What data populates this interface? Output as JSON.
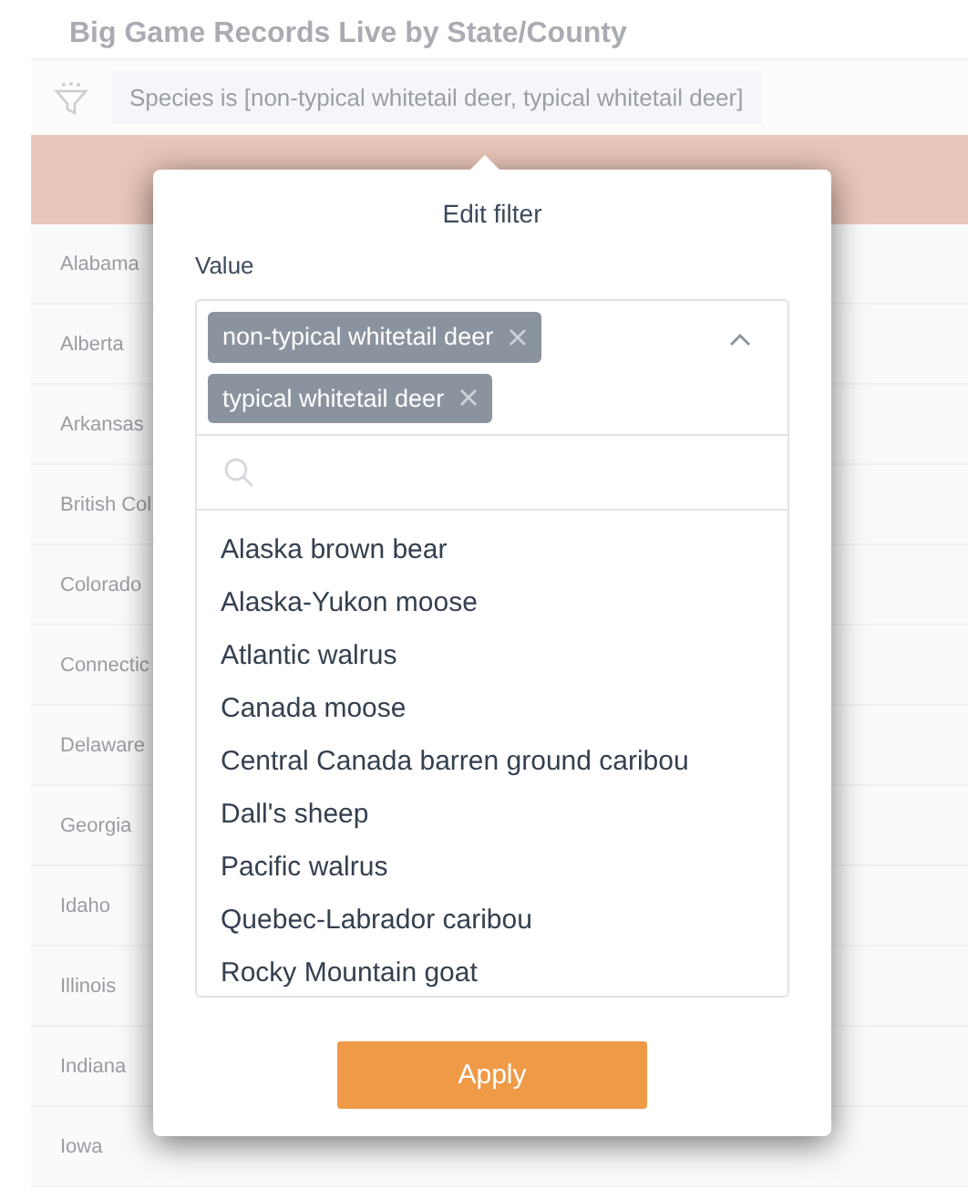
{
  "page_title": "Big Game Records Live by State/County",
  "filter": {
    "text": "Species is [non-typical whitetail deer, typical whitetail deer]"
  },
  "table": {
    "rows": [
      "Alabama",
      "Alberta",
      "Arkansas",
      "British Col",
      "Colorado",
      "Connectic",
      "Delaware",
      "Georgia",
      "Idaho",
      "Illinois",
      "Indiana",
      "Iowa"
    ]
  },
  "popup": {
    "title": "Edit filter",
    "field_label": "Value",
    "expanded": true,
    "chips": [
      "non-typical whitetail deer",
      "typical whitetail deer"
    ],
    "options": [
      "Alaska brown bear",
      "Alaska-Yukon moose",
      "Atlantic walrus",
      "Canada moose",
      "Central Canada barren ground caribou",
      "Dall's sheep",
      "Pacific walrus",
      "Quebec-Labrador caribou",
      "Rocky Mountain goat"
    ],
    "apply_button": "Apply"
  }
}
